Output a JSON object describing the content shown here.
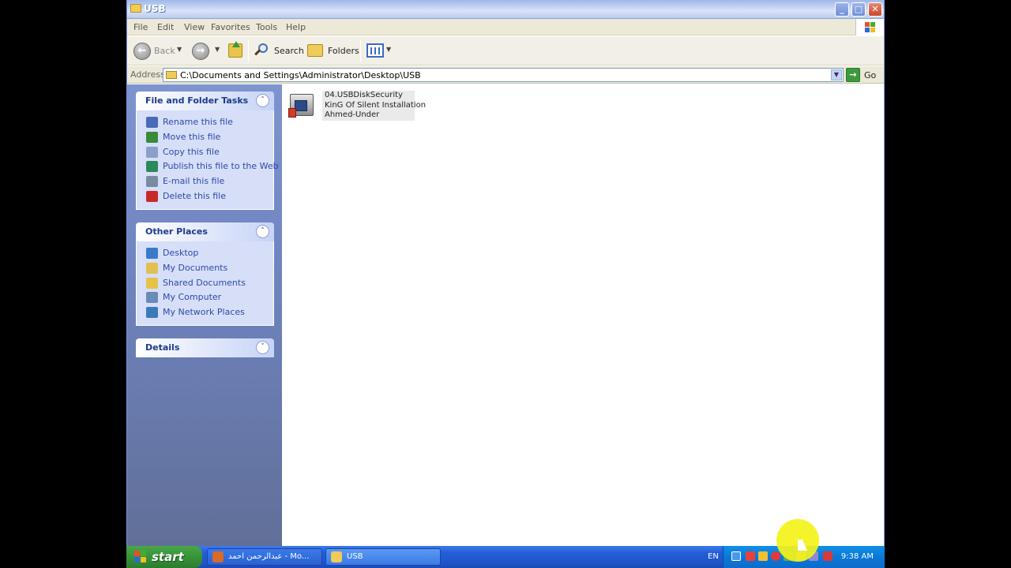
{
  "window": {
    "title": "USB",
    "controls": {
      "minimize": "_",
      "maximize": "□",
      "close": "✕"
    }
  },
  "menubar": [
    "File",
    "Edit",
    "View",
    "Favorites",
    "Tools",
    "Help"
  ],
  "toolbar": {
    "back_label": "Back",
    "search_label": "Search",
    "folders_label": "Folders"
  },
  "address": {
    "label": "Address",
    "value": "C:\\Documents and Settings\\Administrator\\Desktop\\USB",
    "go_label": "Go"
  },
  "tasks": {
    "file_folder": {
      "title": "File and Folder Tasks",
      "items": [
        {
          "label": "Rename this file",
          "icon": "rename-icon",
          "color": "#4a6ab8"
        },
        {
          "label": "Move this file",
          "icon": "move-icon",
          "color": "#3a8a3a"
        },
        {
          "label": "Copy this file",
          "icon": "copy-icon",
          "color": "#8aa0c8"
        },
        {
          "label": "Publish this file to the Web",
          "icon": "globe-icon",
          "color": "#2a8a5a"
        },
        {
          "label": "E-mail this file",
          "icon": "email-icon",
          "color": "#7a8aa0"
        },
        {
          "label": "Delete this file",
          "icon": "delete-icon",
          "color": "#c82a2a"
        }
      ]
    },
    "other_places": {
      "title": "Other Places",
      "items": [
        {
          "label": "Desktop",
          "icon": "desktop-icon",
          "color": "#3a7ac8"
        },
        {
          "label": "My Documents",
          "icon": "documents-icon",
          "color": "#e0c050"
        },
        {
          "label": "Shared Documents",
          "icon": "folder-icon",
          "color": "#e8c248"
        },
        {
          "label": "My Computer",
          "icon": "computer-icon",
          "color": "#6a8ab8"
        },
        {
          "label": "My Network Places",
          "icon": "network-icon",
          "color": "#3a7ab8"
        }
      ]
    },
    "details": {
      "title": "Details"
    }
  },
  "file": {
    "line1": "04.USBDiskSecurity",
    "line2": "KinG Of Silent Installation",
    "line3": "Ahmed-Under"
  },
  "taskbar": {
    "start_label": "start",
    "tasks": [
      {
        "label": "عبدالرحمن احمد - Mo...",
        "icon": "firefox-icon"
      },
      {
        "label": "USB",
        "icon": "folder-icon"
      }
    ],
    "language": "EN",
    "clock": "9:38 AM"
  }
}
